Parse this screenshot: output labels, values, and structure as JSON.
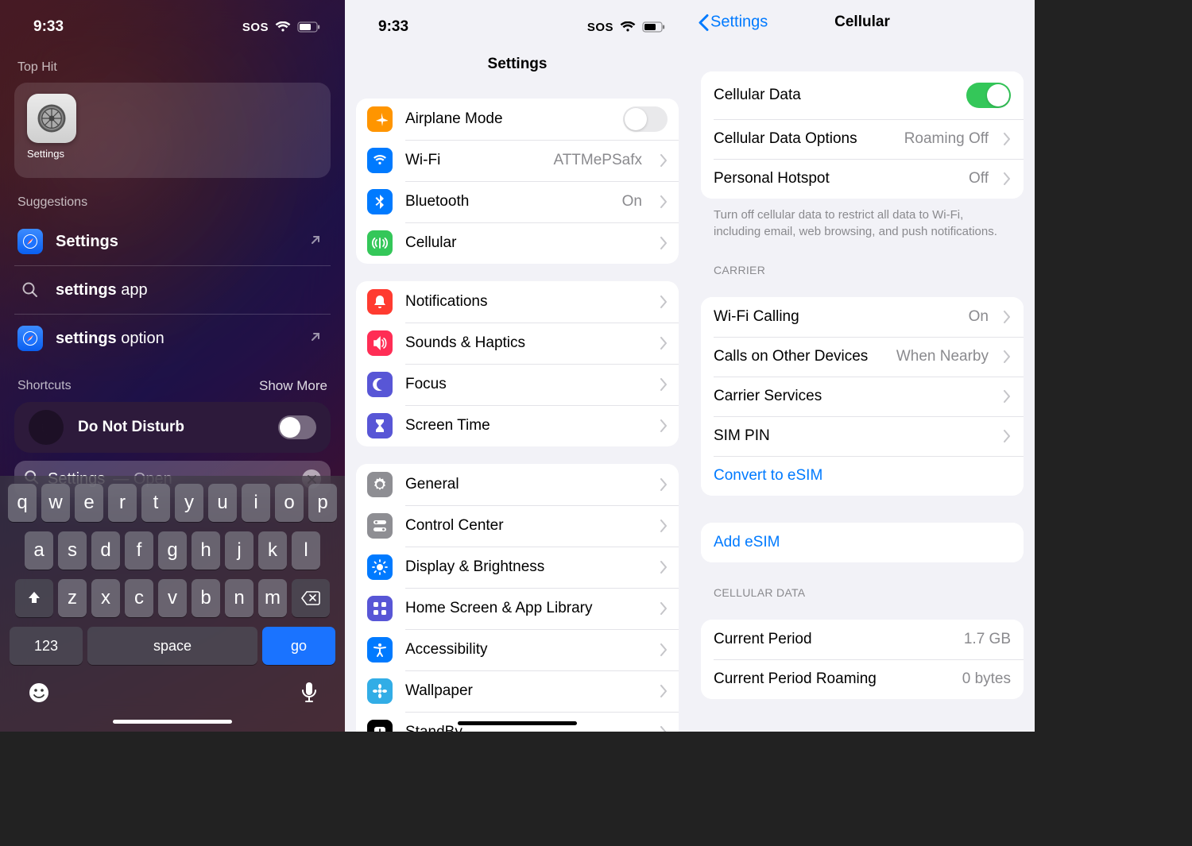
{
  "screen1": {
    "status": {
      "time": "9:33",
      "sos": "SOS"
    },
    "top_hit_hdr": "Top Hit",
    "top_hit_label": "Settings",
    "suggestions_hdr": "Suggestions",
    "suggestions": [
      {
        "bold": "Settings",
        "rest": ""
      },
      {
        "bold": "settings",
        "rest": " app"
      },
      {
        "bold": "settings",
        "rest": " option"
      }
    ],
    "shortcuts_hdr": "Shortcuts",
    "show_more": "Show More",
    "dnd_label": "Do Not Disturb",
    "search_text": "Settings",
    "search_hint": " — Open",
    "keyboard": {
      "row1": [
        "q",
        "w",
        "e",
        "r",
        "t",
        "y",
        "u",
        "i",
        "o",
        "p"
      ],
      "row2": [
        "a",
        "s",
        "d",
        "f",
        "g",
        "h",
        "j",
        "k",
        "l"
      ],
      "row3": [
        "z",
        "x",
        "c",
        "v",
        "b",
        "n",
        "m"
      ],
      "k123": "123",
      "space": "space",
      "go": "go"
    }
  },
  "screen2": {
    "status": {
      "time": "9:33",
      "sos": "SOS"
    },
    "title": "Settings",
    "groups": [
      [
        {
          "icon": "airplane",
          "bg": "bg-orange",
          "label": "Airplane Mode",
          "switch": false
        },
        {
          "icon": "wifi",
          "bg": "bg-blue",
          "label": "Wi-Fi",
          "value": "ATTMePSafx",
          "chevron": true
        },
        {
          "icon": "bluetooth",
          "bg": "bg-blue",
          "label": "Bluetooth",
          "value": "On",
          "chevron": true
        },
        {
          "icon": "antenna",
          "bg": "bg-green",
          "label": "Cellular",
          "chevron": true
        }
      ],
      [
        {
          "icon": "bell",
          "bg": "bg-red",
          "label": "Notifications",
          "chevron": true
        },
        {
          "icon": "speaker",
          "bg": "bg-pink",
          "label": "Sounds & Haptics",
          "chevron": true
        },
        {
          "icon": "moon",
          "bg": "bg-indigo",
          "label": "Focus",
          "chevron": true
        },
        {
          "icon": "hourglass",
          "bg": "bg-indigo",
          "label": "Screen Time",
          "chevron": true
        }
      ],
      [
        {
          "icon": "gear",
          "bg": "bg-gray",
          "label": "General",
          "chevron": true
        },
        {
          "icon": "toggles",
          "bg": "bg-gray",
          "label": "Control Center",
          "chevron": true
        },
        {
          "icon": "brightness",
          "bg": "bg-blue",
          "label": "Display & Brightness",
          "chevron": true
        },
        {
          "icon": "grid",
          "bg": "bg-indigo",
          "label": "Home Screen & App Library",
          "chevron": true
        },
        {
          "icon": "accessibility",
          "bg": "bg-blue",
          "label": "Accessibility",
          "chevron": true
        },
        {
          "icon": "flower",
          "bg": "bg-teal",
          "label": "Wallpaper",
          "chevron": true
        },
        {
          "icon": "standby",
          "bg": "bg-black",
          "label": "StandBy",
          "chevron": true
        }
      ]
    ]
  },
  "screen3": {
    "back": "Settings",
    "title": "Cellular",
    "group1": [
      {
        "label": "Cellular Data",
        "switch": true
      },
      {
        "label": "Cellular Data Options",
        "value": "Roaming Off",
        "chevron": true
      },
      {
        "label": "Personal Hotspot",
        "value": "Off",
        "chevron": true
      }
    ],
    "note1": "Turn off cellular data to restrict all data to Wi-Fi, including email, web browsing, and push notifications.",
    "carrier_hdr": "CARRIER",
    "group2": [
      {
        "label": "Wi-Fi Calling",
        "value": "On",
        "chevron": true
      },
      {
        "label": "Calls on Other Devices",
        "value": "When Nearby",
        "chevron": true
      },
      {
        "label": "Carrier Services",
        "chevron": true
      },
      {
        "label": "SIM PIN",
        "chevron": true
      },
      {
        "label": "Convert to eSIM",
        "link": true
      }
    ],
    "group3": [
      {
        "label": "Add eSIM",
        "link": true
      }
    ],
    "cellular_data_hdr": "CELLULAR DATA",
    "group4": [
      {
        "label": "Current Period",
        "value": "1.7 GB"
      },
      {
        "label": "Current Period Roaming",
        "value": "0 bytes"
      }
    ]
  }
}
